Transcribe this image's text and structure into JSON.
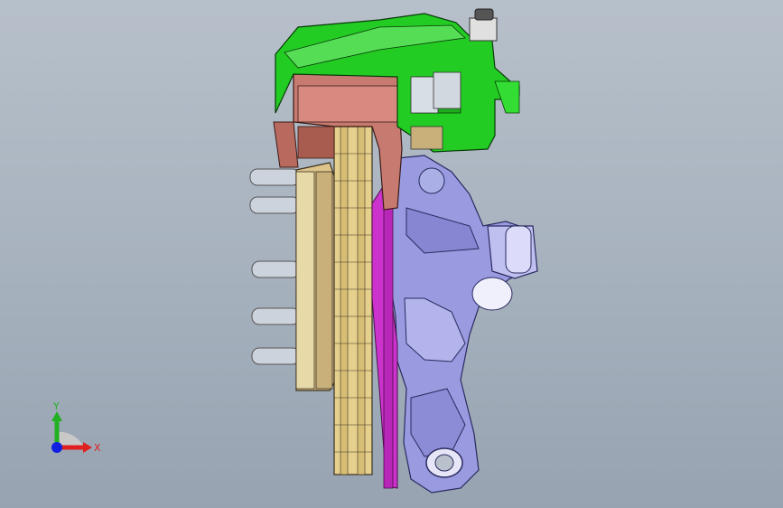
{
  "viewport": {
    "background_top": "#b7c0ca",
    "background_bottom": "#97a3b1"
  },
  "model": {
    "parts": [
      {
        "name": "caliper",
        "color": "#22cc22"
      },
      {
        "name": "caliper-bracket",
        "color": "#c77b70"
      },
      {
        "name": "rotor",
        "color": "#e6d08e"
      },
      {
        "name": "hub",
        "color": "#dcc48a"
      },
      {
        "name": "wheel-studs",
        "color": "#cdd3dc"
      },
      {
        "name": "dust-shield",
        "color": "#cc33cc"
      },
      {
        "name": "steering-knuckle",
        "color": "#9a9ae0"
      }
    ]
  },
  "triad": {
    "y_label": "Y",
    "x_label": "X",
    "y_color": "#22b022",
    "x_color": "#e02020",
    "z_color": "#1020e0"
  }
}
